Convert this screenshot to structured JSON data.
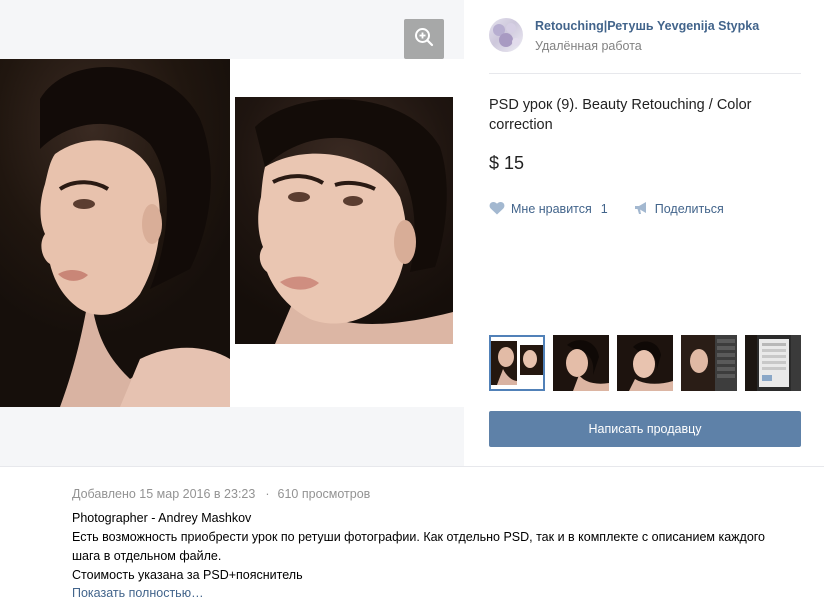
{
  "gallery": {
    "zoom_icon": "zoom-in-icon",
    "before_photo": "portrait-before-retouch",
    "after_photo": "portrait-after-retouch"
  },
  "seller": {
    "name": "Retouching|Ретушь Yevgenija Stypka",
    "subtitle": "Удалённая работа"
  },
  "product": {
    "title": "PSD урок (9). Beauty Retouching / Color correction",
    "price": "$ 15"
  },
  "actions": {
    "like_label": "Мне нравится",
    "like_count": "1",
    "share_label": "Поделиться",
    "like_icon": "heart-icon",
    "share_icon": "megaphone-icon"
  },
  "thumbnails": [
    {
      "name": "before-after-comparison",
      "active": true
    },
    {
      "name": "portrait-profile",
      "active": false
    },
    {
      "name": "portrait-front",
      "active": false
    },
    {
      "name": "photoshop-layers-screenshot",
      "active": false
    },
    {
      "name": "photoshop-panel-screenshot",
      "active": false
    }
  ],
  "contact_button": "Написать продавцу",
  "post": {
    "added": "Добавлено 15 мар 2016 в 23:23",
    "separator": "·",
    "views": "610 просмотров",
    "description": [
      "Photographer - Andrey Mashkov",
      "Есть возможность приобрести урок по ретуши фотографии. Как отдельно PSD, так и в комплекте с описанием каждого шага в отдельном файле.",
      "Стоимость указана за PSD+пояснитель"
    ],
    "show_more": "Показать полностью…"
  },
  "colors": {
    "link": "#42648b",
    "button": "#5e81a8",
    "active_thumb_border": "#5181b8",
    "muted_text": "#828282"
  }
}
